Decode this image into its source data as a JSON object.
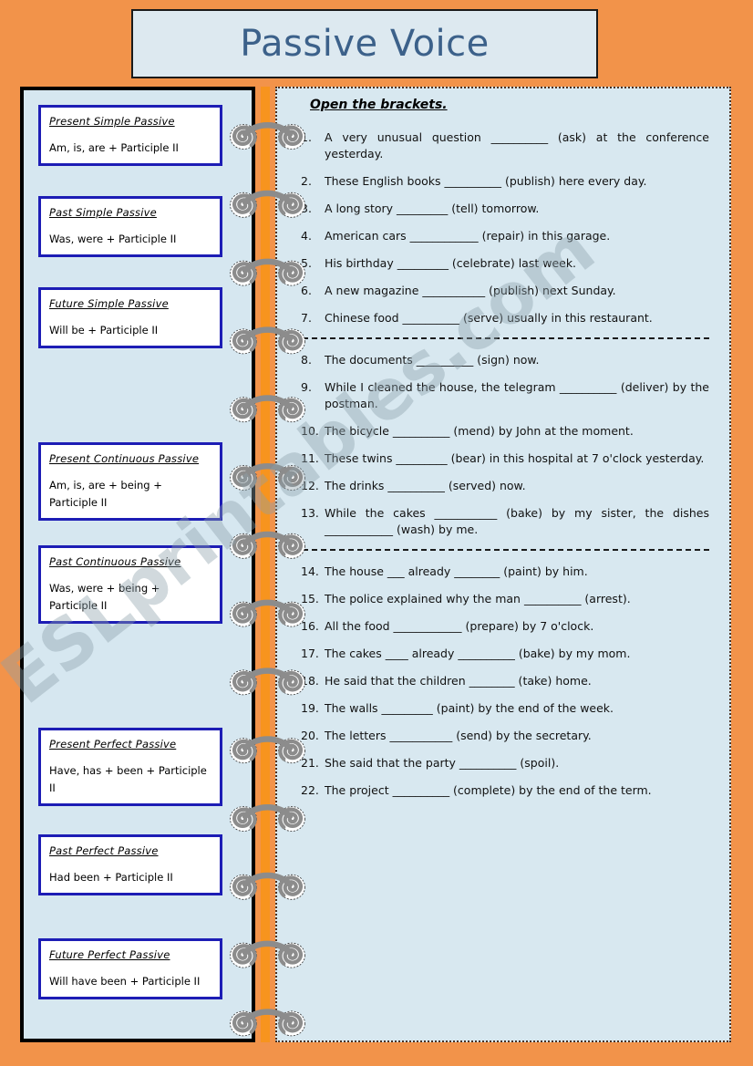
{
  "page": {
    "title": "Passive Voice",
    "background_color": "#f2934a",
    "panel_color": "#d8e8f0",
    "title_color": "#3c618a",
    "box_border_color": "#1d1db5",
    "binding_color": "#f7941e",
    "watermark": "ESLprintables.com"
  },
  "grammar_boxes": [
    {
      "title": "Present Simple Passive",
      "formula": "Am, is, are + Participle II"
    },
    {
      "title": "Past Simple Passive",
      "formula": "Was, were + Participle II"
    },
    {
      "title": "Future Simple Passive",
      "formula": "Will be + Participle II"
    },
    {
      "title": "Present Continuous Passive",
      "formula": "Am, is, are + being + Participle II"
    },
    {
      "title": "Past Continuous Passive",
      "formula": "Was, were + being + Participle II"
    },
    {
      "title": "Present Perfect Passive",
      "formula": "Have, has + been + Participle II"
    },
    {
      "title": "Past Perfect Passive",
      "formula": "Had been + Participle II"
    },
    {
      "title": "Future Perfect Passive",
      "formula": "Will have been + Participle II"
    }
  ],
  "exercise": {
    "heading": "Open the brackets.",
    "items": [
      {
        "num": "1.",
        "text": "A very unusual question __________ (ask) at the conference yesterday."
      },
      {
        "num": "2.",
        "text": "These English books __________ (publish) here every day."
      },
      {
        "num": "3.",
        "text": "A long story _________ (tell) tomorrow."
      },
      {
        "num": "4.",
        "text": "American cars ____________ (repair) in this garage."
      },
      {
        "num": "5.",
        "text": "His birthday _________ (celebrate) last week."
      },
      {
        "num": "6.",
        "text": "A new magazine ___________ (publish) next Sunday."
      },
      {
        "num": "7.",
        "text": "Chinese food __________ (serve) usually in this restaurant."
      },
      {
        "num": "8.",
        "text": "The documents __________ (sign) now."
      },
      {
        "num": "9.",
        "text": "While I cleaned the house, the telegram __________ (deliver) by the postman."
      },
      {
        "num": "10.",
        "text": "The bicycle __________ (mend) by John at the moment."
      },
      {
        "num": "11.",
        "text": "These twins _________ (bear) in this hospital at 7 o'clock yesterday."
      },
      {
        "num": "12.",
        "text": "The drinks __________ (served) now."
      },
      {
        "num": "13.",
        "text": "While the cakes ___________ (bake) by my sister, the dishes ____________ (wash) by me."
      },
      {
        "num": "14.",
        "text": "The house ___ already ________ (paint) by him."
      },
      {
        "num": "15.",
        "text": "The police explained why the man __________ (arrest)."
      },
      {
        "num": "16.",
        "text": "All the food ____________ (prepare) by 7 o'clock."
      },
      {
        "num": "17.",
        "text": "The cakes ____ already __________ (bake) by my mom."
      },
      {
        "num": "18.",
        "text": "He said that the children ________ (take) home."
      },
      {
        "num": "19.",
        "text": "The walls _________ (paint) by the end of the week."
      },
      {
        "num": "20.",
        "text": "The letters ___________ (send) by the secretary."
      },
      {
        "num": "21.",
        "text": "She said that the party __________ (spoil)."
      },
      {
        "num": "22.",
        "text": "The project __________ (complete) by the end of the term."
      }
    ],
    "separator_after": [
      "7.",
      "13."
    ]
  }
}
